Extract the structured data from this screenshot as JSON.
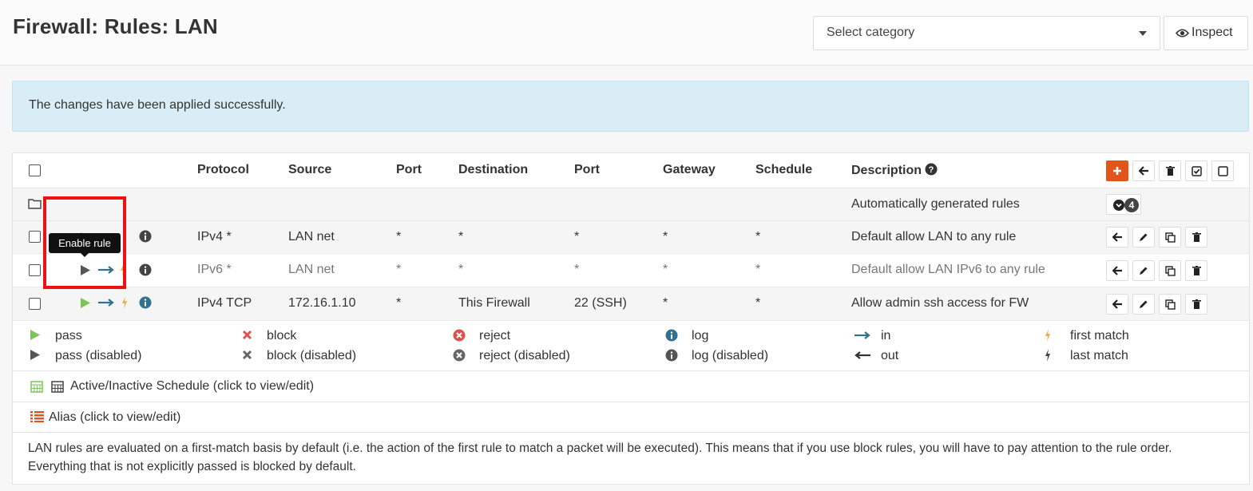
{
  "header": {
    "title": "Firewall: Rules: LAN",
    "category_select": "Select category",
    "inspect_label": "Inspect"
  },
  "alert": {
    "message": "The changes have been applied successfully."
  },
  "table": {
    "columns": {
      "protocol": "Protocol",
      "source": "Source",
      "port": "Port",
      "destination": "Destination",
      "port2": "Port",
      "gateway": "Gateway",
      "schedule": "Schedule",
      "description": "Description"
    },
    "auto_group": {
      "description": "Automatically generated rules",
      "count": "4"
    },
    "rows": [
      {
        "protocol": "IPv4 *",
        "source": "LAN net",
        "port": "*",
        "destination": "*",
        "dport": "*",
        "gateway": "*",
        "schedule": "*",
        "description": "Default allow LAN to any rule",
        "disabled": false
      },
      {
        "protocol": "IPv6 *",
        "source": "LAN net",
        "port": "*",
        "destination": "*",
        "dport": "*",
        "gateway": "*",
        "schedule": "*",
        "description": "Default allow LAN IPv6 to any rule",
        "disabled": true
      },
      {
        "protocol": "IPv4 TCP",
        "source": "172.16.1.10",
        "port": "*",
        "destination": "This Firewall",
        "dport": "22 (SSH)",
        "gateway": "*",
        "schedule": "*",
        "description": "Allow admin ssh access for FW",
        "disabled": false
      }
    ]
  },
  "tooltip": {
    "text": "Enable rule"
  },
  "legend": {
    "pass": "pass",
    "pass_disabled": "pass (disabled)",
    "block": "block",
    "block_disabled": "block (disabled)",
    "reject": "reject",
    "reject_disabled": "reject (disabled)",
    "log": "log",
    "log_disabled": "log (disabled)",
    "in": "in",
    "out": "out",
    "first_match": "first match",
    "last_match": "last match"
  },
  "schedule_note": "Active/Inactive Schedule (click to view/edit)",
  "alias_note": "Alias (click to view/edit)",
  "footer_note": "LAN rules are evaluated on a first-match basis by default (i.e. the action of the first rule to match a packet will be executed). This means that if you use block rules, you will have to pay attention to the rule order. Everything that is not explicitly passed is blocked by default.",
  "colors": {
    "pass": "#7fc35b",
    "block": "#d9534f",
    "accent": "#e2541a",
    "info": "#31708f",
    "lightning": "#f0ad4e",
    "alert_bg": "#d9edf7"
  }
}
